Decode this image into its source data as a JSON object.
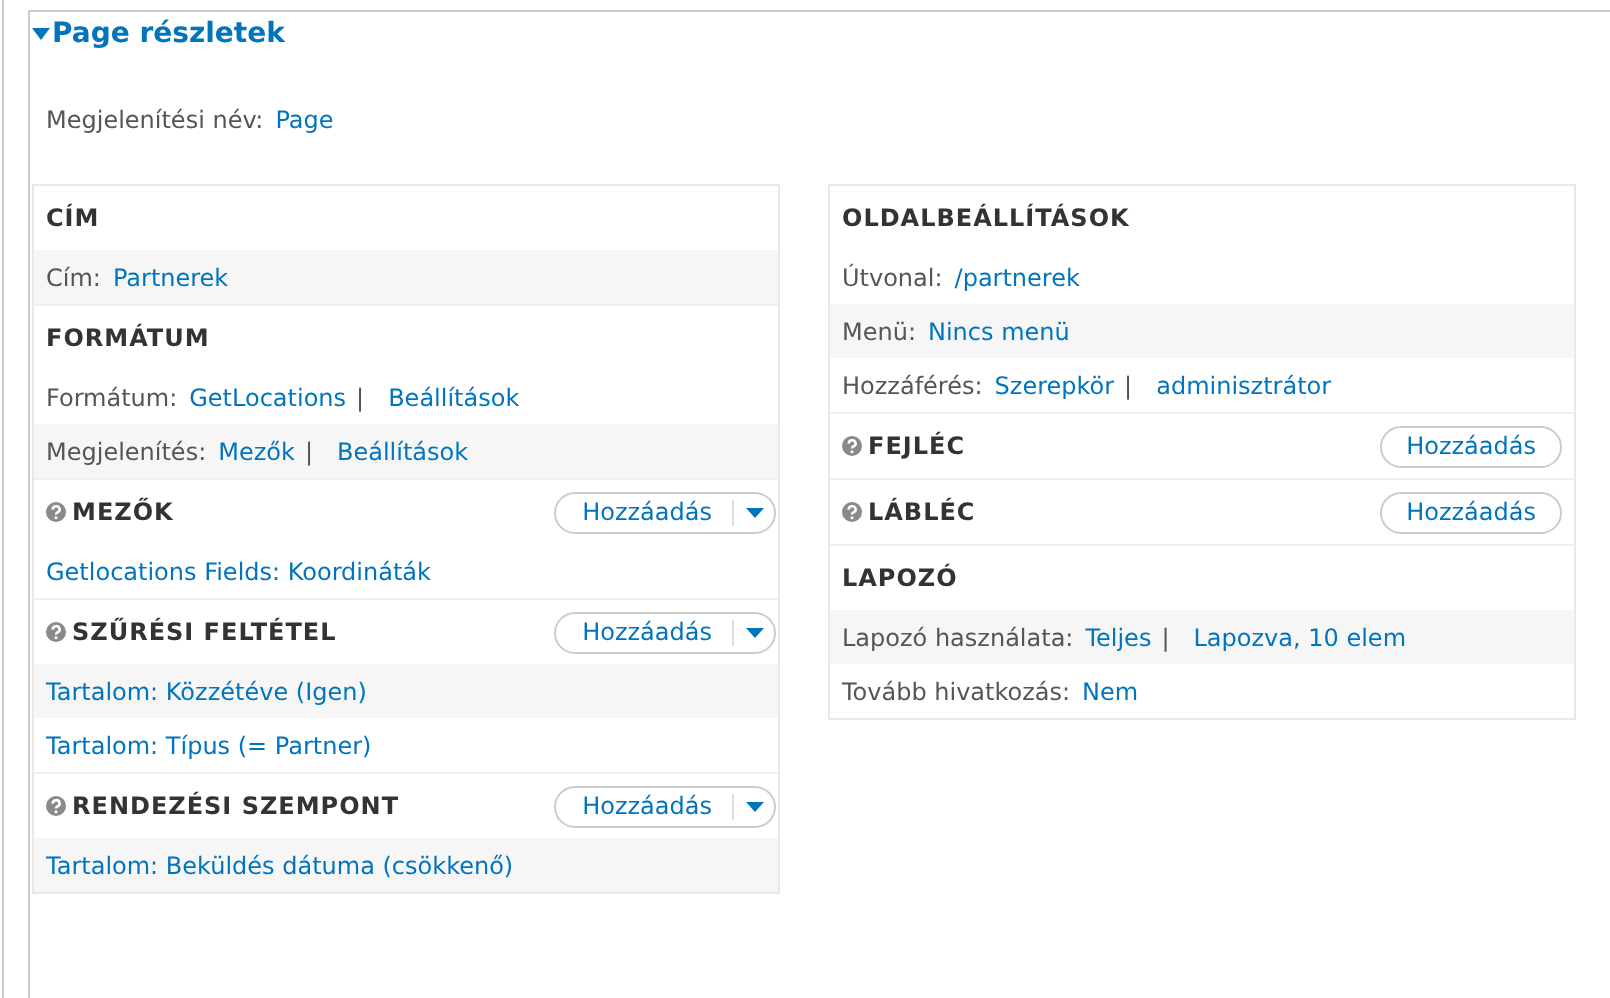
{
  "fieldset": {
    "title": "Page részletek",
    "expanded": true,
    "display_name": [
      {
        "kind": "label",
        "text": "Megjelenítési név:"
      },
      {
        "kind": "link",
        "text": "Page"
      }
    ],
    "columns": [
      {
        "sections": [
          {
            "title": "CÍM",
            "help": false,
            "kind": "plain",
            "rows": [
              {
                "shaded": true,
                "parts": [
                  {
                    "kind": "label",
                    "text": "Cím:"
                  },
                  {
                    "kind": "link",
                    "text": "Partnerek"
                  }
                ]
              }
            ]
          },
          {
            "title": "FORMÁTUM",
            "help": false,
            "kind": "plain",
            "rows": [
              {
                "shaded": false,
                "parts": [
                  {
                    "kind": "label",
                    "text": "Formátum:"
                  },
                  {
                    "kind": "link",
                    "text": "GetLocations"
                  },
                  {
                    "kind": "sep",
                    "text": "|"
                  },
                  {
                    "kind": "link",
                    "text": "Beállítások"
                  }
                ]
              },
              {
                "shaded": true,
                "parts": [
                  {
                    "kind": "label",
                    "text": "Megjelenítés:"
                  },
                  {
                    "kind": "link",
                    "text": "Mezők"
                  },
                  {
                    "kind": "sep",
                    "text": "|"
                  },
                  {
                    "kind": "link",
                    "text": "Beállítások"
                  }
                ]
              }
            ]
          },
          {
            "title": "MEZŐK",
            "help": true,
            "kind": "split",
            "add_label": "Hozzáadás",
            "rows": [
              {
                "shaded": false,
                "parts": [
                  {
                    "kind": "link",
                    "text": "Getlocations Fields: Koordináták"
                  }
                ]
              }
            ]
          },
          {
            "title": "SZŰRÉSI FELTÉTEL",
            "help": true,
            "kind": "split",
            "add_label": "Hozzáadás",
            "rows": [
              {
                "shaded": true,
                "parts": [
                  {
                    "kind": "link",
                    "text": "Tartalom: Közzétéve (Igen)"
                  }
                ]
              },
              {
                "shaded": false,
                "parts": [
                  {
                    "kind": "link",
                    "text": "Tartalom: Típus (= Partner)"
                  }
                ]
              }
            ]
          },
          {
            "title": "RENDEZÉSI SZEMPONT",
            "help": true,
            "kind": "split",
            "add_label": "Hozzáadás",
            "rows": [
              {
                "shaded": true,
                "parts": [
                  {
                    "kind": "link",
                    "text": "Tartalom: Beküldés dátuma (csökkenő)"
                  }
                ]
              }
            ]
          }
        ]
      },
      {
        "sections": [
          {
            "title": "OLDALBEÁLLÍTÁSOK",
            "help": false,
            "kind": "plain",
            "rows": [
              {
                "shaded": false,
                "parts": [
                  {
                    "kind": "label",
                    "text": "Útvonal:"
                  },
                  {
                    "kind": "link",
                    "text": "/partnerek"
                  }
                ]
              },
              {
                "shaded": true,
                "parts": [
                  {
                    "kind": "label",
                    "text": "Menü:"
                  },
                  {
                    "kind": "link",
                    "text": "Nincs menü"
                  }
                ]
              },
              {
                "shaded": false,
                "parts": [
                  {
                    "kind": "label",
                    "text": "Hozzáférés:"
                  },
                  {
                    "kind": "link",
                    "text": "Szerepkör"
                  },
                  {
                    "kind": "sep",
                    "text": "|"
                  },
                  {
                    "kind": "link",
                    "text": "adminisztrátor"
                  }
                ]
              }
            ]
          },
          {
            "title": "FEJLÉC",
            "help": true,
            "kind": "button",
            "add_label": "Hozzáadás"
          },
          {
            "title": "LÁBLÉC",
            "help": true,
            "kind": "button",
            "add_label": "Hozzáadás"
          },
          {
            "title": "LAPOZÓ",
            "help": false,
            "kind": "plain",
            "rows": [
              {
                "shaded": true,
                "parts": [
                  {
                    "kind": "label",
                    "text": "Lapozó használata:"
                  },
                  {
                    "kind": "link",
                    "text": "Teljes"
                  },
                  {
                    "kind": "sep",
                    "text": "|"
                  },
                  {
                    "kind": "link",
                    "text": "Lapozva, 10 elem"
                  }
                ]
              },
              {
                "shaded": false,
                "parts": [
                  {
                    "kind": "label",
                    "text": "Tovább hivatkozás:"
                  },
                  {
                    "kind": "link",
                    "text": "Nem"
                  }
                ]
              }
            ]
          }
        ]
      }
    ]
  }
}
